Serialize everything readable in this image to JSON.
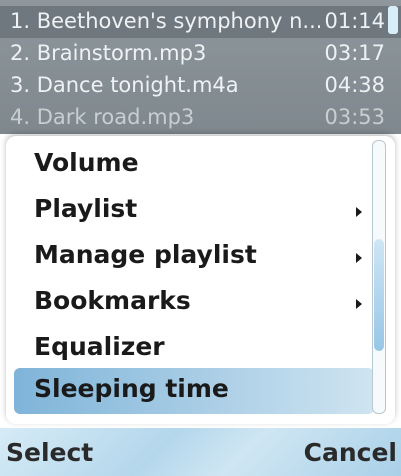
{
  "playlist": {
    "tracks": [
      {
        "title": "1. Beethoven's symphony n...",
        "duration": "01:14"
      },
      {
        "title": "2. Brainstorm.mp3",
        "duration": "03:17"
      },
      {
        "title": "3. Dance tonight.m4a",
        "duration": "04:38"
      },
      {
        "title": "4. Dark road.mp3",
        "duration": "03:53"
      }
    ]
  },
  "menu": {
    "items": [
      {
        "label": "Volume",
        "has_submenu": false
      },
      {
        "label": "Playlist",
        "has_submenu": true
      },
      {
        "label": "Manage playlist",
        "has_submenu": true
      },
      {
        "label": "Bookmarks",
        "has_submenu": true
      },
      {
        "label": "Equalizer",
        "has_submenu": false
      },
      {
        "label": "Sleeping time",
        "has_submenu": false,
        "selected": true
      }
    ]
  },
  "softkeys": {
    "left": "Select",
    "right": "Cancel"
  },
  "colors": {
    "selection_start": "#7fb4d9",
    "softkey_bar": "#b4d7ec"
  }
}
